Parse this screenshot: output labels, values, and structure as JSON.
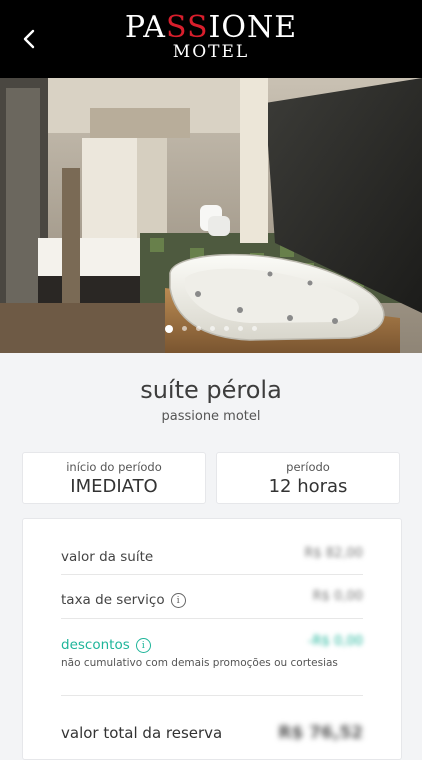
{
  "header": {
    "logo_line1_a": "PA",
    "logo_line1_b": "SS",
    "logo_line1_c": "IONE",
    "logo_line2": "MOTEL"
  },
  "gallery": {
    "image_count": 7,
    "active_index": 0
  },
  "suite": {
    "title": "suíte pérola",
    "motel": "passione motel"
  },
  "period_start": {
    "label": "início do período",
    "value": "IMEDIATO"
  },
  "period": {
    "label": "período",
    "value": "12 horas"
  },
  "pricing": {
    "suite_value_label": "valor da suíte",
    "suite_value": "R$ 82,00",
    "service_fee_label": "taxa de serviço",
    "service_fee": "R$ 0,00",
    "discounts_label": "descontos",
    "discounts": "-R$ 0,00",
    "discounts_note": "não cumulativo com demais promoções ou cortesias",
    "total_label": "valor total da reserva",
    "total": "R$ 76,52"
  },
  "colors": {
    "accent_green": "#1fb59a",
    "logo_red": "#d81e2c"
  }
}
